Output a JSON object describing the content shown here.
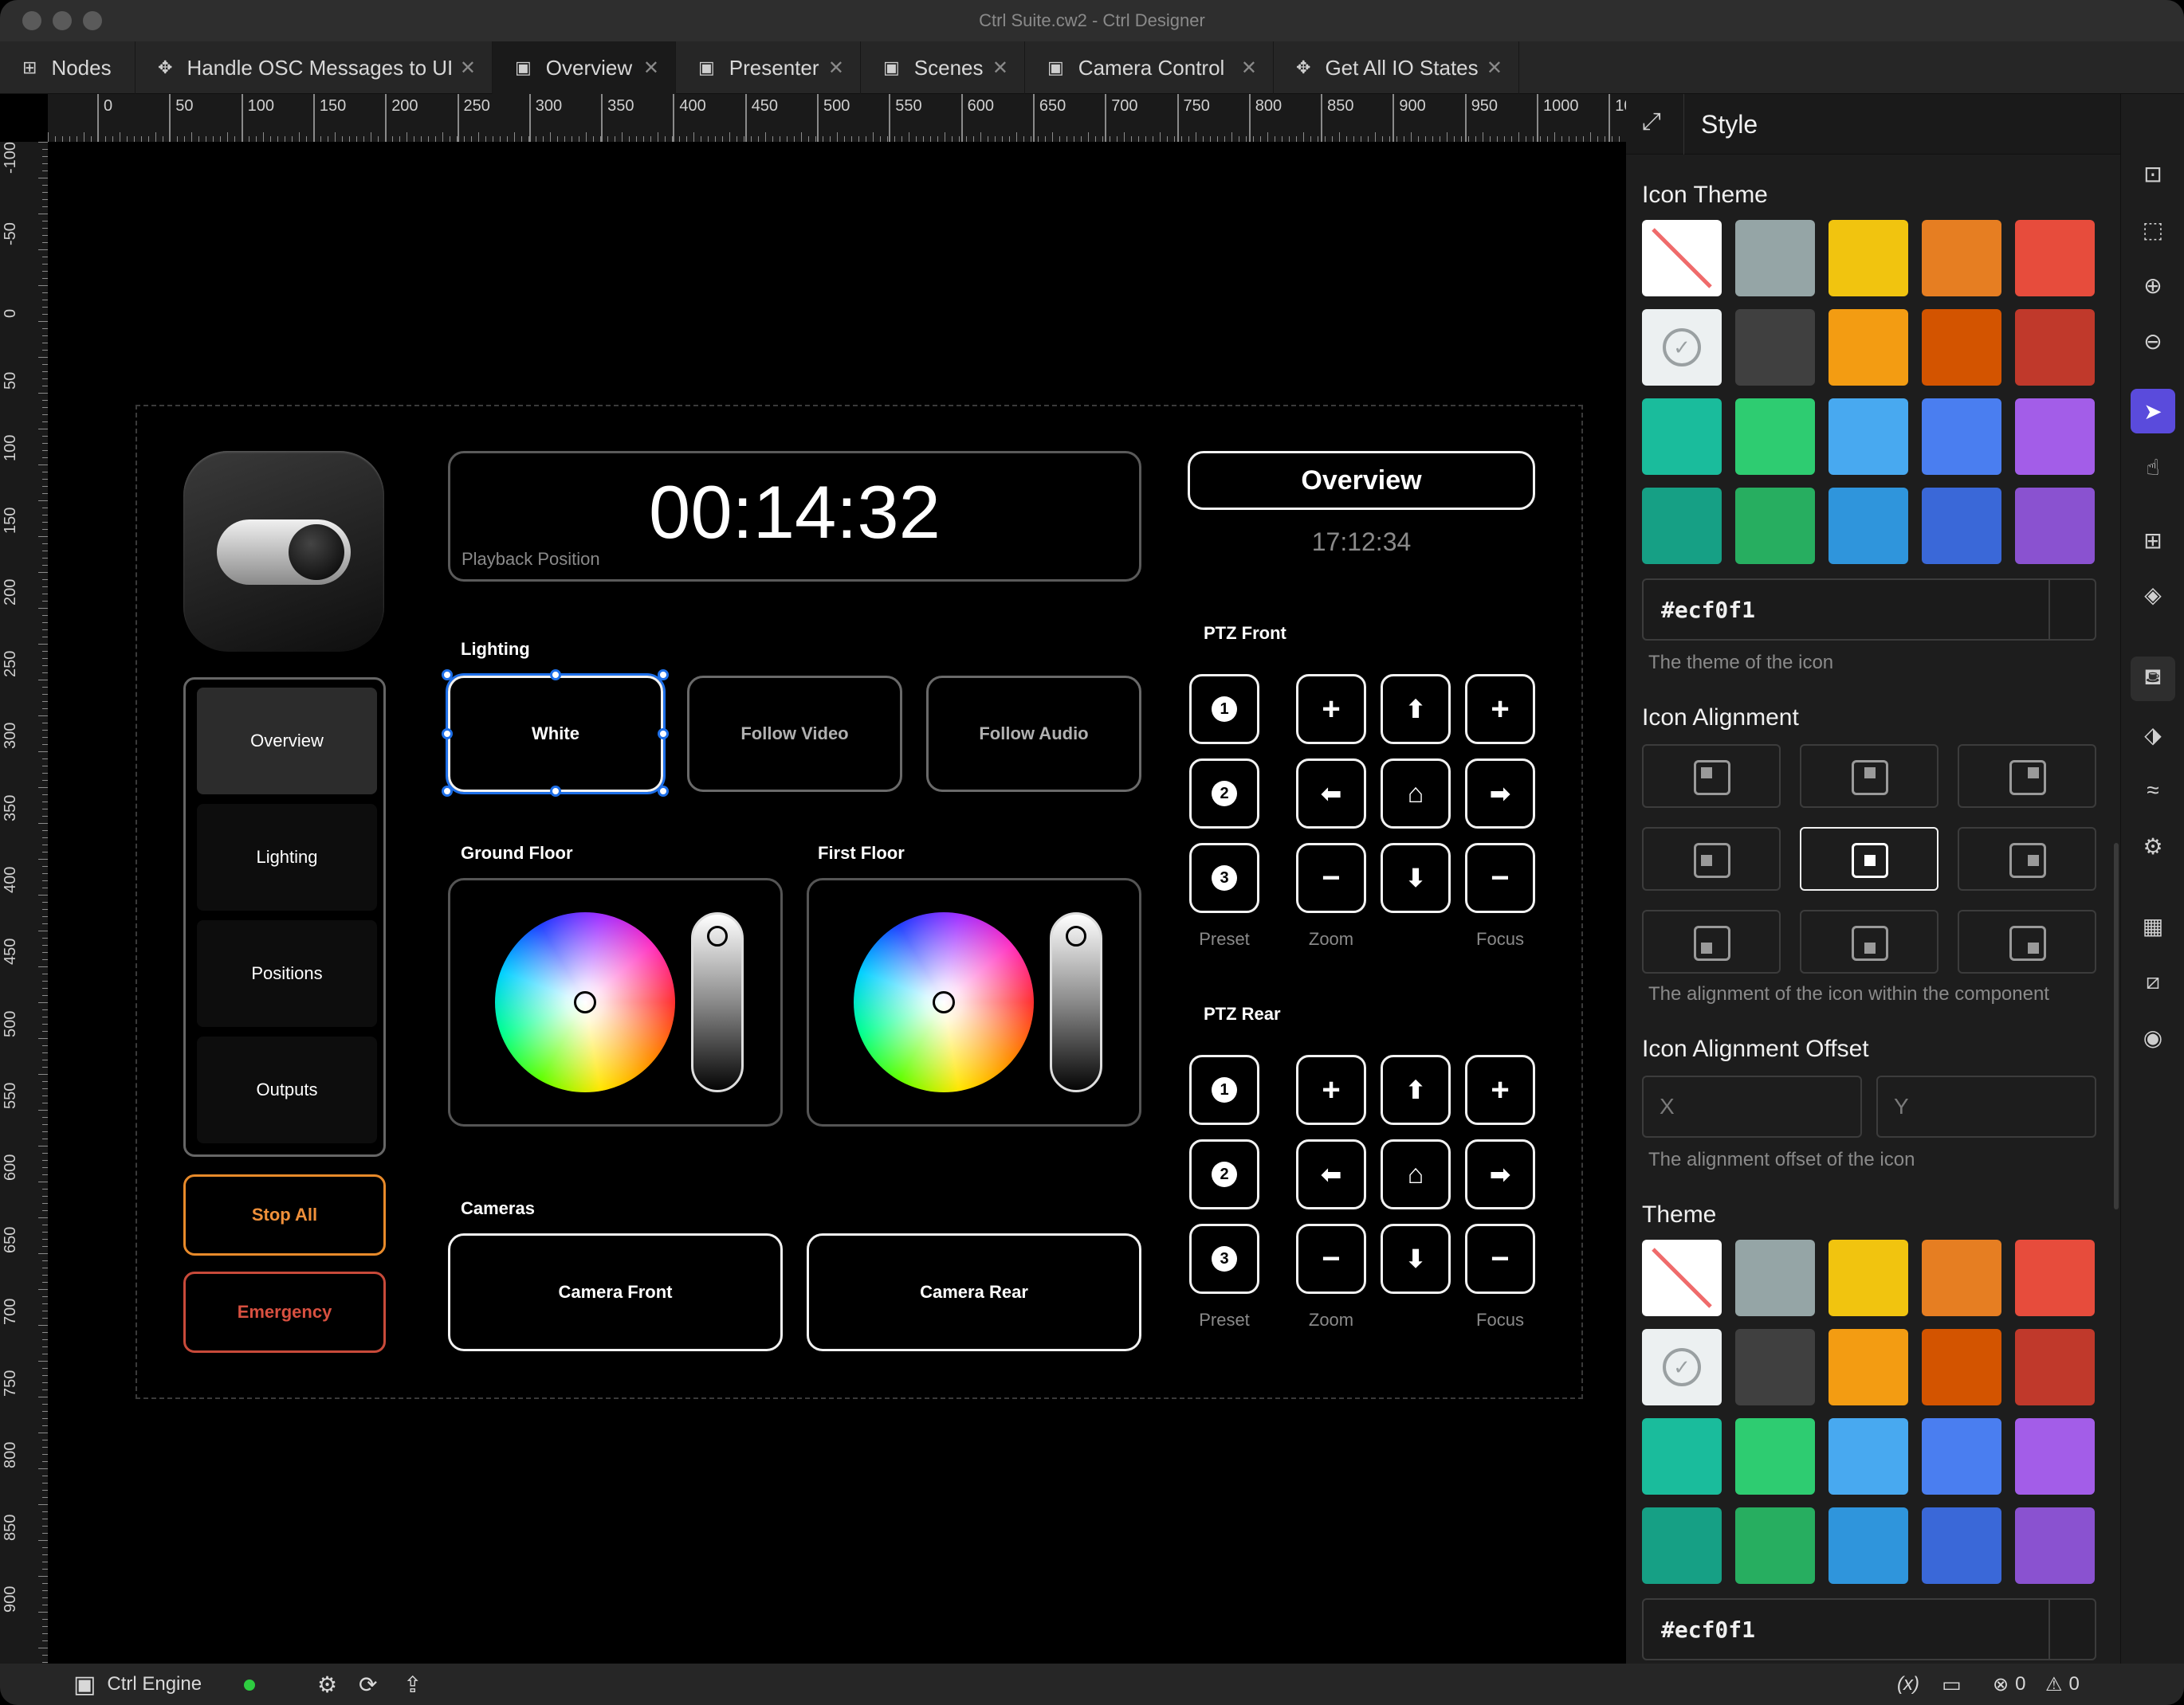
{
  "window": {
    "title": "Ctrl Suite.cw2 - Ctrl Designer"
  },
  "tabs": [
    {
      "label": "Nodes",
      "icon": "nodes-icon",
      "closable": false
    },
    {
      "label": "Handle OSC Messages to UI",
      "icon": "node-graph-icon",
      "closable": true
    },
    {
      "label": "Overview",
      "icon": "monitor-icon",
      "closable": true
    },
    {
      "label": "Presenter",
      "icon": "monitor-icon",
      "closable": true
    },
    {
      "label": "Scenes",
      "icon": "monitor-icon",
      "closable": true
    },
    {
      "label": "Camera Control",
      "icon": "monitor-icon",
      "closable": true
    },
    {
      "label": "Get All IO States",
      "icon": "node-graph-icon",
      "closable": true
    }
  ],
  "ruler": {
    "top": [
      "0",
      "0",
      "50",
      "100",
      "150",
      "200",
      "250",
      "300",
      "350",
      "400",
      "450",
      "500",
      "550",
      "600",
      "650",
      "700",
      "750",
      "800",
      "850",
      "900",
      "950",
      "1000",
      "10"
    ],
    "left": [
      "-100",
      "-50",
      "0",
      "50",
      "100",
      "150",
      "200",
      "250",
      "300",
      "350",
      "400",
      "450",
      "500",
      "550",
      "600",
      "650",
      "700",
      "750",
      "800",
      "850",
      "900"
    ]
  },
  "canvas": {
    "nav": {
      "items": [
        "Overview",
        "Lighting",
        "Positions",
        "Outputs"
      ],
      "selected": 0
    },
    "stop_all": "Stop All",
    "emergency": "Emergency",
    "timer": {
      "value": "00:14:32",
      "caption": "Playback Position"
    },
    "overview_title": "Overview",
    "clock": "17:12:34",
    "lighting": {
      "label": "Lighting",
      "buttons": [
        "White",
        "Follow Video",
        "Follow Audio"
      ]
    },
    "ground_floor": "Ground Floor",
    "first_floor": "First Floor",
    "cameras": {
      "label": "Cameras",
      "buttons": [
        "Camera Front",
        "Camera Rear"
      ]
    },
    "ptz_front": {
      "label": "PTZ Front",
      "presets": [
        "1",
        "2",
        "3"
      ],
      "captions": [
        "Preset",
        "Zoom",
        "Focus"
      ]
    },
    "ptz_rear": {
      "label": "PTZ Rear",
      "presets": [
        "1",
        "2",
        "3"
      ],
      "captions": [
        "Preset",
        "Zoom",
        "Focus"
      ]
    }
  },
  "panel": {
    "title": "Style",
    "icon_theme": {
      "title": "Icon Theme",
      "value": "#ecf0f1",
      "desc": "The theme of the icon",
      "colors": [
        "#ffffff",
        "#95a5a6",
        "#f1c40f",
        "#e67e22",
        "#e74c3c",
        "#ecf0f1",
        "#404040",
        "#f39c12",
        "#d35400",
        "#c0392b",
        "#1abc9c",
        "#2ecc71",
        "#48a9f0",
        "#4a7ef0",
        "#a35de8",
        "#16a085",
        "#27ae60",
        "#2f95dc",
        "#3a68d8",
        "#8a52d0"
      ]
    },
    "icon_alignment": {
      "title": "Icon Alignment",
      "desc": "The alignment of the icon within the component",
      "selected": 4
    },
    "icon_alignment_offset": {
      "title": "Icon Alignment Offset",
      "x_placeholder": "X",
      "y_placeholder": "Y",
      "desc": "The alignment offset of the icon"
    },
    "theme": {
      "title": "Theme",
      "value": "#ecf0f1",
      "colors": [
        "#ffffff",
        "#95a5a6",
        "#f1c40f",
        "#e67e22",
        "#e74c3c",
        "#ecf0f1",
        "#404040",
        "#f39c12",
        "#d35400",
        "#c0392b",
        "#1abc9c",
        "#2ecc71",
        "#48a9f0",
        "#4a7ef0",
        "#a35de8",
        "#16a085",
        "#27ae60",
        "#2f95dc",
        "#3a68d8",
        "#8a52d0"
      ]
    }
  },
  "toolbar": [
    "fit-icon",
    "zoom-area-icon",
    "zoom-in-icon",
    "zoom-out-icon",
    "pointer-icon",
    "hand-icon",
    "add-icon",
    "layers-icon",
    "paint-bucket-icon",
    "tag-icon",
    "script-icon",
    "gear-icon",
    "grid-icon",
    "crop-icon",
    "camera-icon"
  ],
  "status": {
    "engine": "Ctrl Engine",
    "engine_status_color": "#2ecc40",
    "errors": "0",
    "warnings": "0"
  }
}
